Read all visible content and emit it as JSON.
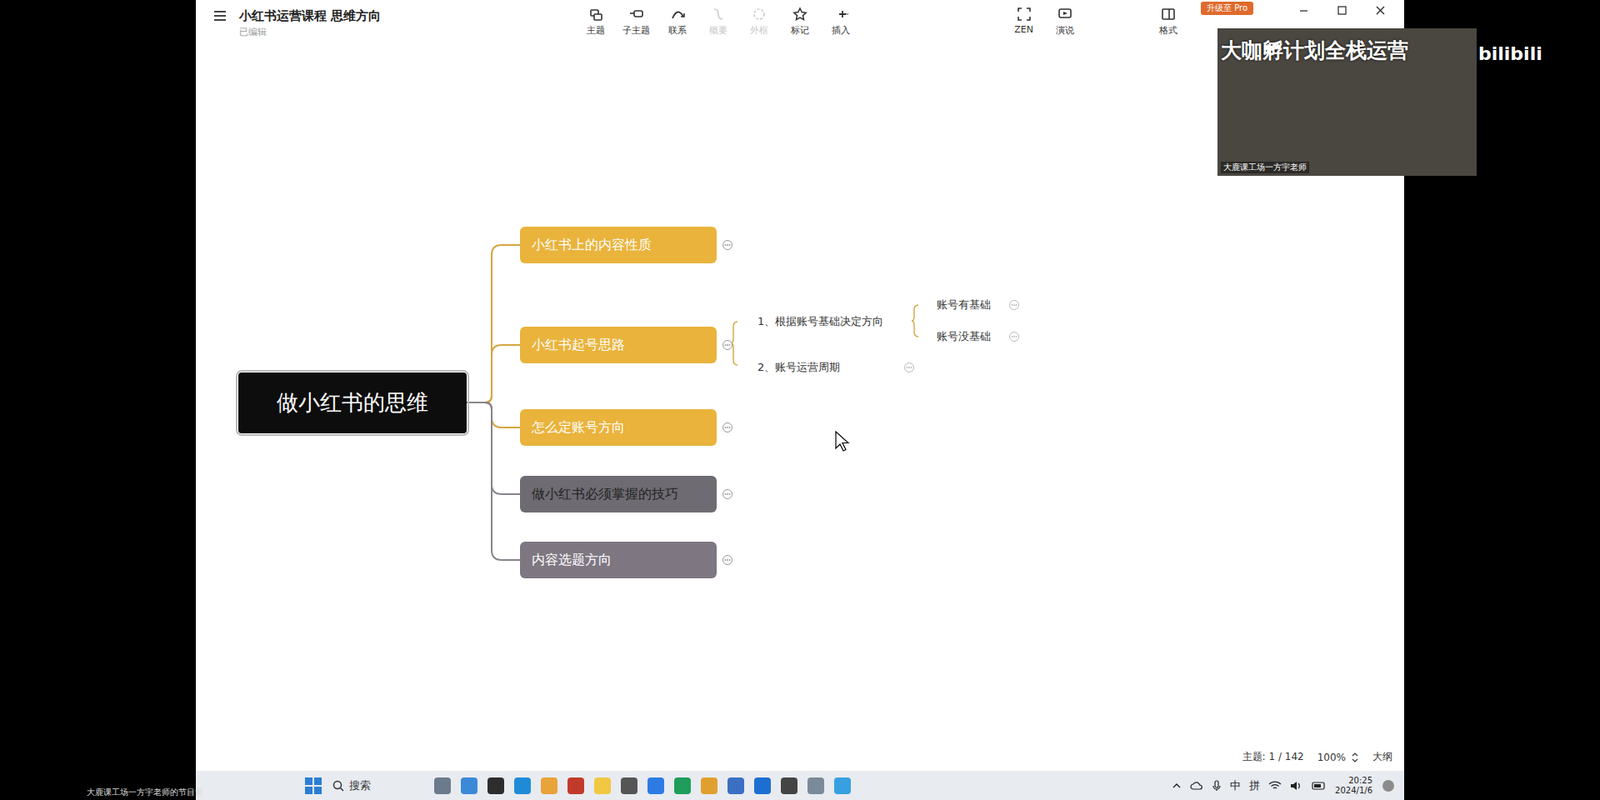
{
  "window": {
    "title": "小红书运营课程 思维方向",
    "subtitle": "已编辑",
    "upgrade": "升级至 Pro"
  },
  "toolbar": [
    {
      "label": "主题",
      "disabled": false
    },
    {
      "label": "子主题",
      "disabled": false
    },
    {
      "label": "联系",
      "disabled": false
    },
    {
      "label": "概要",
      "disabled": true
    },
    {
      "label": "外框",
      "disabled": true
    },
    {
      "label": "标记",
      "disabled": false
    },
    {
      "label": "插入",
      "disabled": false
    }
  ],
  "toolbar_right": [
    {
      "label": "ZEN"
    },
    {
      "label": "演说"
    },
    {
      "label": "格式"
    }
  ],
  "mindmap": {
    "root": "做小红书的思维",
    "branches": [
      {
        "label": "小红书上的内容性质",
        "color": "#e9b33c",
        "dimmed": false,
        "children": []
      },
      {
        "label": "小红书起号思路",
        "color": "#e9b33c",
        "dimmed": false,
        "children": [
          {
            "label": "1、根据账号基础决定方向",
            "children": [
              {
                "label": "账号有基础"
              },
              {
                "label": "账号没基础"
              }
            ]
          },
          {
            "label": "2、账号运营周期",
            "children": []
          }
        ]
      },
      {
        "label": "怎么定账号方向",
        "color": "#e9b33c",
        "dimmed": false,
        "children": []
      },
      {
        "label": "做小红书必须掌握的技巧",
        "color": "#6f6b73",
        "dimmed": true,
        "children": []
      },
      {
        "label": "内容选题方向",
        "color": "#7e7782",
        "dimmed": false,
        "children": []
      }
    ]
  },
  "status_bar": {
    "topics": "主题: 1 / 142",
    "zoom": "100%",
    "outline": "大纲"
  },
  "taskbar": {
    "search": "搜索",
    "ime": [
      "中",
      "拼"
    ],
    "time": "20:25",
    "date": "2024/1/6"
  },
  "video": {
    "overlay": "大咖孵计划全栈运营",
    "watermark": "bilibili",
    "presenter": "大鹿课工场一方宇老师"
  },
  "caption": "大鹿课工场一方宇老师的节目留"
}
